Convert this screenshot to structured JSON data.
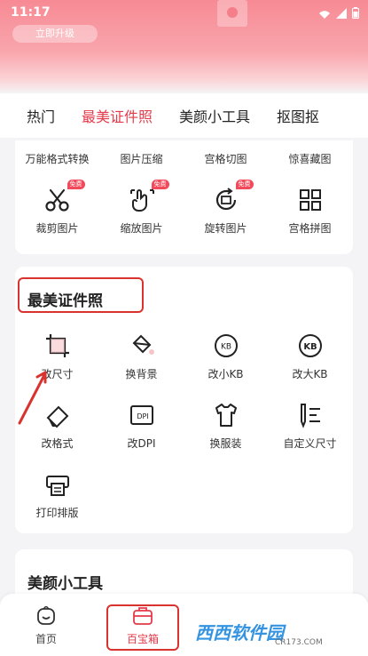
{
  "status_bar": {
    "time": "11:17"
  },
  "header": {
    "upgrade_label": "立即升级"
  },
  "tabs": [
    {
      "label": "热门",
      "active": false
    },
    {
      "label": "最美证件照",
      "active": true
    },
    {
      "label": "美颜小工具",
      "active": false
    },
    {
      "label": "抠图抠",
      "active": false
    }
  ],
  "tools_card": {
    "top_labels": [
      "万能格式转换",
      "图片压缩",
      "宫格切图",
      "惊喜藏图"
    ],
    "items": [
      {
        "label": "裁剪图片",
        "icon": "scissors-icon",
        "badge": "免费"
      },
      {
        "label": "缩放图片",
        "icon": "resize-hand-icon",
        "badge": "免费"
      },
      {
        "label": "旋转图片",
        "icon": "rotate-image-icon",
        "badge": "免费"
      },
      {
        "label": "宫格拼图",
        "icon": "grid-icon",
        "badge": ""
      }
    ]
  },
  "id_photo": {
    "title": "最美证件照",
    "items": [
      {
        "label": "改尺寸",
        "icon": "crop-frame-icon"
      },
      {
        "label": "换背景",
        "icon": "paint-bucket-icon"
      },
      {
        "label": "改小KB",
        "icon": "kb-small-icon",
        "glyph": "KB"
      },
      {
        "label": "改大KB",
        "icon": "kb-large-icon",
        "glyph": "KB"
      },
      {
        "label": "改格式",
        "icon": "eraser-icon"
      },
      {
        "label": "改DPI",
        "icon": "dpi-icon",
        "glyph": "DPI"
      },
      {
        "label": "换服装",
        "icon": "shirt-icon"
      },
      {
        "label": "自定义尺寸",
        "icon": "custom-size-icon"
      },
      {
        "label": "打印排版",
        "icon": "printer-icon"
      }
    ]
  },
  "beauty": {
    "title": "美颜小工具"
  },
  "bottom_nav": [
    {
      "label": "首页",
      "icon": "home-face-icon",
      "active": false
    },
    {
      "label": "百宝箱",
      "icon": "toolbox-icon",
      "active": true
    }
  ],
  "watermark": {
    "brand": "西西软件园",
    "domain": "CR173.COM"
  },
  "colors": {
    "accent": "#e53a4a",
    "annotation": "#d9332f",
    "header_pink": "#f78a94"
  }
}
